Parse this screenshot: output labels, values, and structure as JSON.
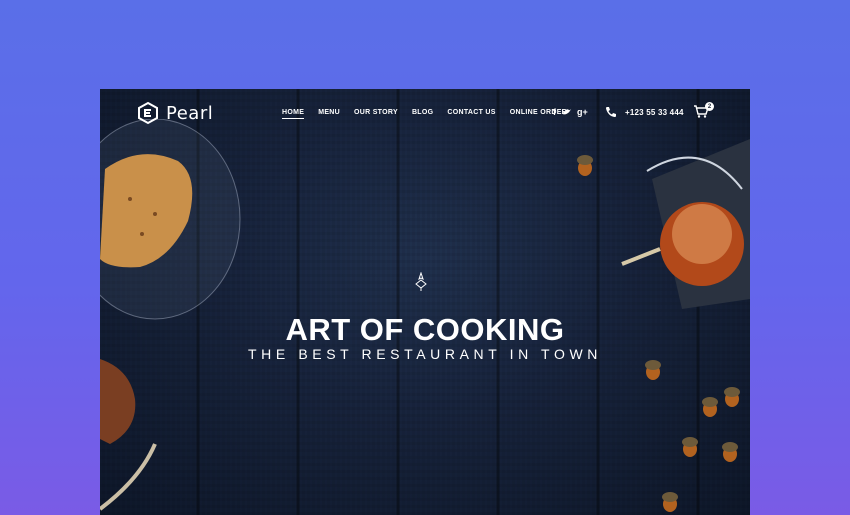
{
  "brand": {
    "name": "Pearl"
  },
  "nav": {
    "items": [
      {
        "label": "HOME",
        "active": true
      },
      {
        "label": "MENU",
        "active": false
      },
      {
        "label": "OUR STORY",
        "active": false
      },
      {
        "label": "BLOG",
        "active": false
      },
      {
        "label": "CONTACT US",
        "active": false
      },
      {
        "label": "ONLINE ORDER",
        "active": false
      }
    ]
  },
  "social": {
    "facebook": "f",
    "twitter": "t",
    "googleplus": "g+"
  },
  "contact": {
    "phone": "+123 55 33 444"
  },
  "cart": {
    "count": "2"
  },
  "hero": {
    "title": "ART OF COOKING",
    "subtitle": "THE BEST RESTAURANT IN TOWN"
  },
  "colors": {
    "page_bg": "#5a6fe8",
    "wood_dark": "#16223a",
    "text": "#ffffff"
  },
  "icons": [
    "logo-mark-icon",
    "facebook-icon",
    "twitter-icon",
    "google-plus-icon",
    "phone-icon",
    "cart-icon",
    "ornament-icon"
  ]
}
